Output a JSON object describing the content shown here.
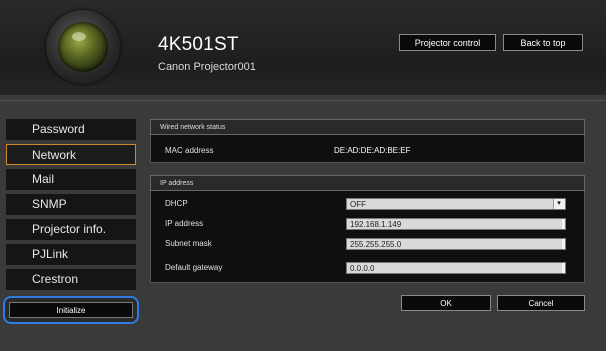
{
  "header": {
    "model": "4K501ST",
    "projector_name": "Canon Projector001",
    "buttons": {
      "projector_control": "Projector control",
      "back_to_top": "Back to top"
    }
  },
  "sidebar": {
    "items": [
      {
        "label": "Password"
      },
      {
        "label": "Network",
        "active": true
      },
      {
        "label": "Mail"
      },
      {
        "label": "SNMP"
      },
      {
        "label": "Projector info."
      },
      {
        "label": "PJLink"
      },
      {
        "label": "Crestron"
      }
    ],
    "initialize_label": "Initialize"
  },
  "wired_status": {
    "title": "Wired network status",
    "mac_label": "MAC address",
    "mac_value": "DE:AD:DE:AD:BE:EF"
  },
  "ip_address": {
    "title": "IP address",
    "dhcp_label": "DHCP",
    "dhcp_value": "OFF",
    "ip_label": "IP address",
    "ip_value": "192.168.1.149",
    "subnet_label": "Subnet mask",
    "subnet_value": "255.255.255.0",
    "gateway_label": "Default gateway",
    "gateway_value": "0.0.0.0"
  },
  "actions": {
    "ok_label": "OK",
    "cancel_label": "Cancel"
  },
  "colors": {
    "active_border": "#d08a2a",
    "focus_ring": "#2f7ce0"
  }
}
